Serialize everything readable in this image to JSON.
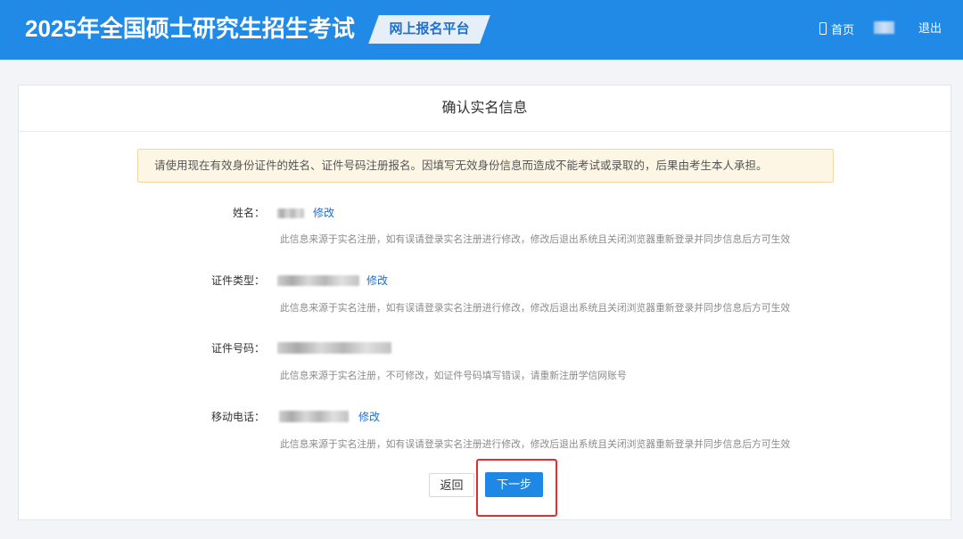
{
  "header": {
    "title": "2025年全国硕士研究生招生考试",
    "platform_badge": "网上报名平台",
    "home_icon": "mobile-phone-icon",
    "home_label": "首页",
    "logout_label": "退出"
  },
  "card": {
    "title": "确认实名信息",
    "notice": "请使用现在有效身份证件的姓名、证件号码注册报名。因填写无效身份信息而造成不能考试或录取的，后果由考生本人承担。",
    "fields": [
      {
        "label": "姓名：",
        "edit_label": "修改",
        "hint": "此信息来源于实名注册，如有误请登录实名注册进行修改，修改后退出系统且关闭浏览器重新登录并同步信息后方可生效"
      },
      {
        "label": "证件类型：",
        "edit_label": "修改",
        "hint": "此信息来源于实名注册，如有误请登录实名注册进行修改，修改后退出系统且关闭浏览器重新登录并同步信息后方可生效"
      },
      {
        "label": "证件号码：",
        "hint": "此信息来源于实名注册，不可修改，如证件号码填写错误，请重新注册学信网账号"
      },
      {
        "label": "移动电话：",
        "edit_label": "修改",
        "hint": "此信息来源于实名注册，如有误请登录实名注册进行修改，修改后退出系统且关闭浏览器重新登录并同步信息后方可生效"
      }
    ],
    "buttons": {
      "back_label": "返回",
      "next_label": "下一步"
    }
  },
  "colors": {
    "header_bg": "#2189e6",
    "page_bg": "#f2f4f7",
    "badge_bg": "#e6eef8",
    "badge_text": "#1f6fcc",
    "link": "#1a6fd2",
    "notice_bg": "#fdf6e4",
    "notice_border": "#f3d7a3",
    "primary_button": "#1f88e5",
    "highlight": "#e02f2f"
  }
}
